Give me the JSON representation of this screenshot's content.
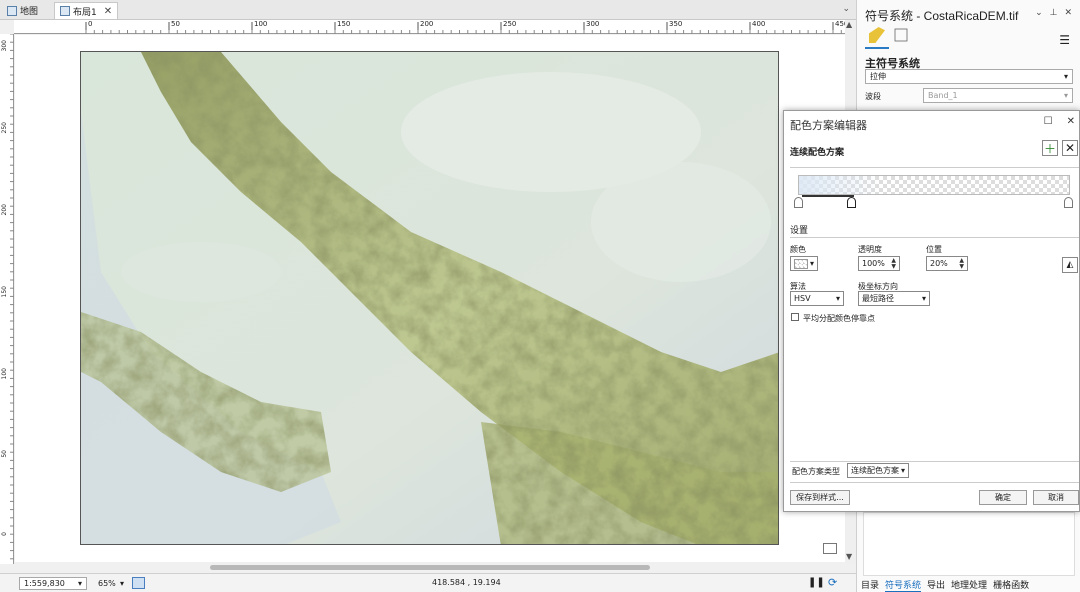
{
  "tabs": [
    {
      "label": "地图",
      "active": false
    },
    {
      "label": "布局1",
      "active": true
    }
  ],
  "ruler": {
    "h_ticks": [
      "0",
      "50",
      "100",
      "150",
      "200",
      "250",
      "300",
      "350",
      "400",
      "450"
    ],
    "v_ticks": [
      "300",
      "250",
      "200",
      "150",
      "100",
      "50",
      "0"
    ]
  },
  "status": {
    "scale": "1:559,830",
    "zoom": "65%",
    "coords": "418.584 , 19.194"
  },
  "pane": {
    "title": "符号系统 - CostaRicaDEM.tif",
    "section": "主符号系统",
    "renderer": "拉伸",
    "band_label": "波段",
    "band_value": "Band_1",
    "tabs": [
      "目录",
      "符号系统",
      "导出",
      "地理处理",
      "栅格函数"
    ],
    "active_tab": "符号系统"
  },
  "dialog": {
    "title": "配色方案编辑器",
    "section": "连续配色方案",
    "settings": "设置",
    "color_label": "颜色",
    "opacity_label": "透明度",
    "opacity_value": "100%",
    "position_label": "位置",
    "position_value": "20%",
    "algo_label": "算法",
    "algo_value": "HSV",
    "polar_label": "极坐标方向",
    "polar_value": "最短路径",
    "checkbox_label": "平均分配颜色停靠点",
    "type_label": "配色方案类型",
    "type_value": "连续配色方案",
    "save_label": "保存到样式...",
    "ok_label": "确定",
    "cancel_label": "取消"
  },
  "colors": {
    "accent": "#1a6fbf",
    "add_green": "#2e8b2e",
    "terrain_high": "#6f7a3a",
    "terrain_mid": "#c9d4a0",
    "terrain_low": "#d6e2d6",
    "water": "#c8d3de"
  }
}
